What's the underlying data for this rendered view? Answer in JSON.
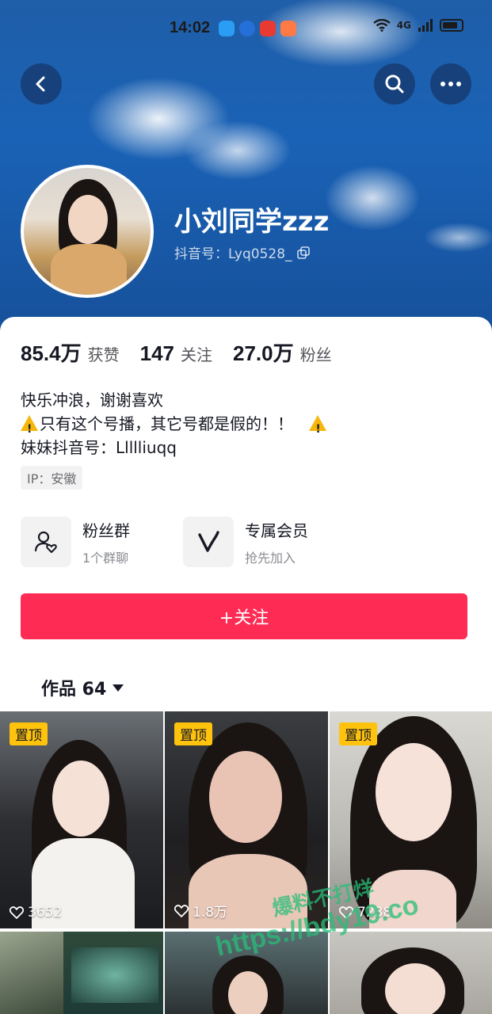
{
  "status_bar": {
    "time": "14:02",
    "network": "4G",
    "app_icons": [
      "message-icon",
      "browser-icon",
      "app-icon",
      "heart-app-icon"
    ]
  },
  "header": {
    "back_icon": "chevron-left-icon",
    "search_icon": "search-icon",
    "more_icon": "more-icon"
  },
  "profile": {
    "nickname": "小刘同学zzz",
    "douyin_id": "抖音号：Lyq0528_",
    "copy_icon": "copy-icon"
  },
  "stats": [
    {
      "value": "85.4万",
      "label": "获赞"
    },
    {
      "value": "147",
      "label": "关注"
    },
    {
      "value": "27.0万",
      "label": "粉丝"
    }
  ],
  "bio": {
    "line1": "快乐冲浪，谢谢喜欢",
    "line2": "只有这个号播，其它号都是假的！！",
    "line3": "妹妹抖音号：Llllliuqq"
  },
  "ip_tag": "IP：安徽",
  "cards": [
    {
      "title": "粉丝群",
      "subtitle": "1个群聊",
      "icon": "fan-group-icon"
    },
    {
      "title": "专属会员",
      "subtitle": "抢先加入",
      "icon": "member-v-icon"
    }
  ],
  "follow_button": "+关注",
  "works_tab": {
    "label": "作品 64"
  },
  "videos": [
    {
      "pinned": "置顶",
      "likes": "3652"
    },
    {
      "pinned": "置顶",
      "likes": "1.8万"
    },
    {
      "pinned": "置顶",
      "likes": "7238"
    }
  ],
  "watermark": {
    "text": "https://bdy19.co",
    "cn": "爆料不打烊"
  },
  "colors": {
    "accent": "#fe2c55",
    "pin": "#ffc30d",
    "hero": "#1a62b6"
  }
}
